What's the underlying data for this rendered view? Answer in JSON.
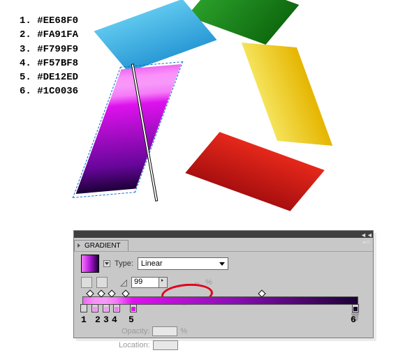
{
  "legend": {
    "items": [
      {
        "n": "1.",
        "hex": "#EE68F0"
      },
      {
        "n": "2.",
        "hex": "#FA91FA"
      },
      {
        "n": "3.",
        "hex": "#F799F9"
      },
      {
        "n": "4.",
        "hex": "#F57BF8"
      },
      {
        "n": "5.",
        "hex": "#DE12ED"
      },
      {
        "n": "6.",
        "hex": "#1C0036"
      }
    ]
  },
  "panel": {
    "title": "GRADIENT",
    "type_label": "Type:",
    "type_value": "Linear",
    "angle_value": "99",
    "angle_unit": "°",
    "aspect_unit": "%",
    "opacity_label": "Opacity:",
    "opacity_unit": "%",
    "location_label": "Location:",
    "flyout_glyph": "◄◄ ▸≡"
  },
  "gradient_stops": {
    "colors": [
      {
        "label": "1",
        "location": 0,
        "hex": "#EE68F0"
      },
      {
        "label": "2",
        "location": 4,
        "hex": "#FA91FA"
      },
      {
        "label": "3",
        "location": 8,
        "hex": "#F799F9"
      },
      {
        "label": "4",
        "location": 12,
        "hex": "#F57BF8"
      },
      {
        "label": "5",
        "location": 18,
        "hex": "#DE12ED"
      },
      {
        "label": "6",
        "location": 100,
        "hex": "#1C0036"
      }
    ],
    "midpoints": [
      2,
      6,
      10,
      15,
      65
    ]
  }
}
